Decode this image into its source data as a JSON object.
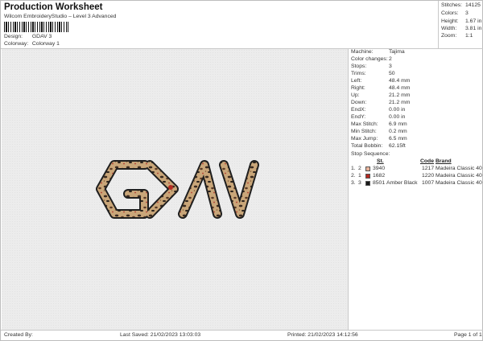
{
  "header": {
    "title": "Production Worksheet",
    "subtitle": "Wilcom EmbroideryStudio – Level 3 Advanced",
    "design_label": "Design:",
    "design_value": "GDAV 3",
    "colorway_label": "Colorway:",
    "colorway_value": "Colorway 1"
  },
  "summary": [
    {
      "k": "Stitches:",
      "v": "14125"
    },
    {
      "k": "Colors:",
      "v": "3"
    },
    {
      "k": "Height:",
      "v": "1.67 in"
    },
    {
      "k": "Width:",
      "v": "3.81 in"
    },
    {
      "k": "Zoom:",
      "v": "1:1"
    }
  ],
  "details": [
    {
      "k": "Machine:",
      "v": "Tajima"
    },
    {
      "k": "Color changes:",
      "v": "2"
    },
    {
      "k": "Stops:",
      "v": "3"
    },
    {
      "k": "Trims:",
      "v": "50"
    },
    {
      "k": "Left:",
      "v": "48.4 mm"
    },
    {
      "k": "Right:",
      "v": "48.4 mm"
    },
    {
      "k": "Up:",
      "v": "21.2 mm"
    },
    {
      "k": "Down:",
      "v": "21.2 mm"
    },
    {
      "k": "EndX:",
      "v": "0.00 in"
    },
    {
      "k": "EndY:",
      "v": "0.00 in"
    },
    {
      "k": "Max Stitch:",
      "v": "6.9 mm"
    },
    {
      "k": "Min Stitch:",
      "v": "0.2 mm"
    },
    {
      "k": "Max Jump:",
      "v": "6.5 mm"
    },
    {
      "k": "Total Bobbin:",
      "v": "62.15ft"
    }
  ],
  "stop_sequence": {
    "title": "Stop Sequence:",
    "columns": {
      "st": "St.",
      "code": "Code",
      "brand": "Brand"
    },
    "rows": [
      {
        "n": "1.",
        "seq": "2",
        "color": "#e8b39a",
        "st": "3940",
        "name": "",
        "code": "1217",
        "brand": "Madeira Classic 40"
      },
      {
        "n": "2.",
        "seq": "1",
        "color": "#b52a22",
        "st": "1682",
        "name": "",
        "code": "1220",
        "brand": "Madeira Classic 40"
      },
      {
        "n": "3.",
        "seq": "3",
        "color": "#1a1a1a",
        "st": "8501",
        "name": "Amber Black",
        "code": "1007",
        "brand": "Madeira Classic 40"
      }
    ]
  },
  "footer": {
    "created_by": "Created By:",
    "last_saved": "Last Saved: 21/02/2023 13:03:03",
    "printed": "Printed: 21/02/2023 14:12:56",
    "page": "Page 1 of 1"
  },
  "design_text": "GDAV"
}
